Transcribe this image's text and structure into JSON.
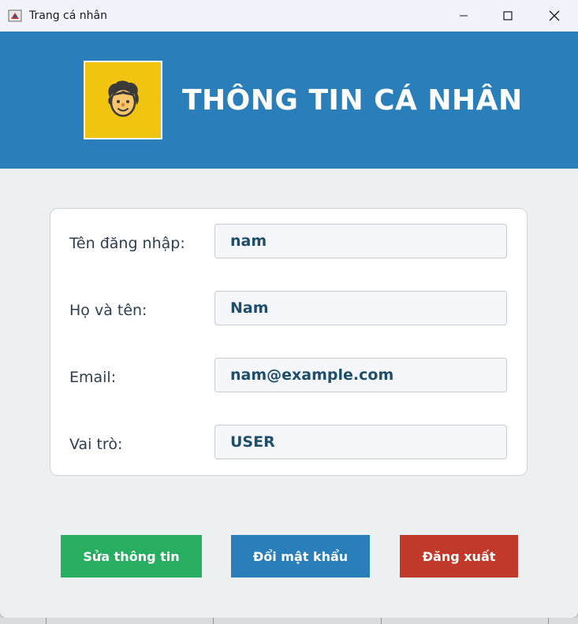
{
  "window": {
    "title": "Trang cá nhân"
  },
  "header": {
    "title": "THÔNG TIN CÁ NHÂN",
    "avatar_icon": "user-avatar-icon",
    "background": "#2a7fba",
    "avatar_background": "#f1c40f"
  },
  "profile": {
    "fields": [
      {
        "label": "Tên đăng nhập:",
        "value": "nam"
      },
      {
        "label": "Họ và tên:",
        "value": "Nam"
      },
      {
        "label": "Email:",
        "value": "nam@example.com"
      },
      {
        "label": "Vai trò:",
        "value": "USER"
      }
    ]
  },
  "actions": {
    "edit_label": "Sửa thông tin",
    "change_password_label": "Đổi mật khẩu",
    "logout_label": "Đăng xuất",
    "edit_color": "#27ae60",
    "change_password_color": "#2a7fba",
    "logout_color": "#c0392b"
  }
}
